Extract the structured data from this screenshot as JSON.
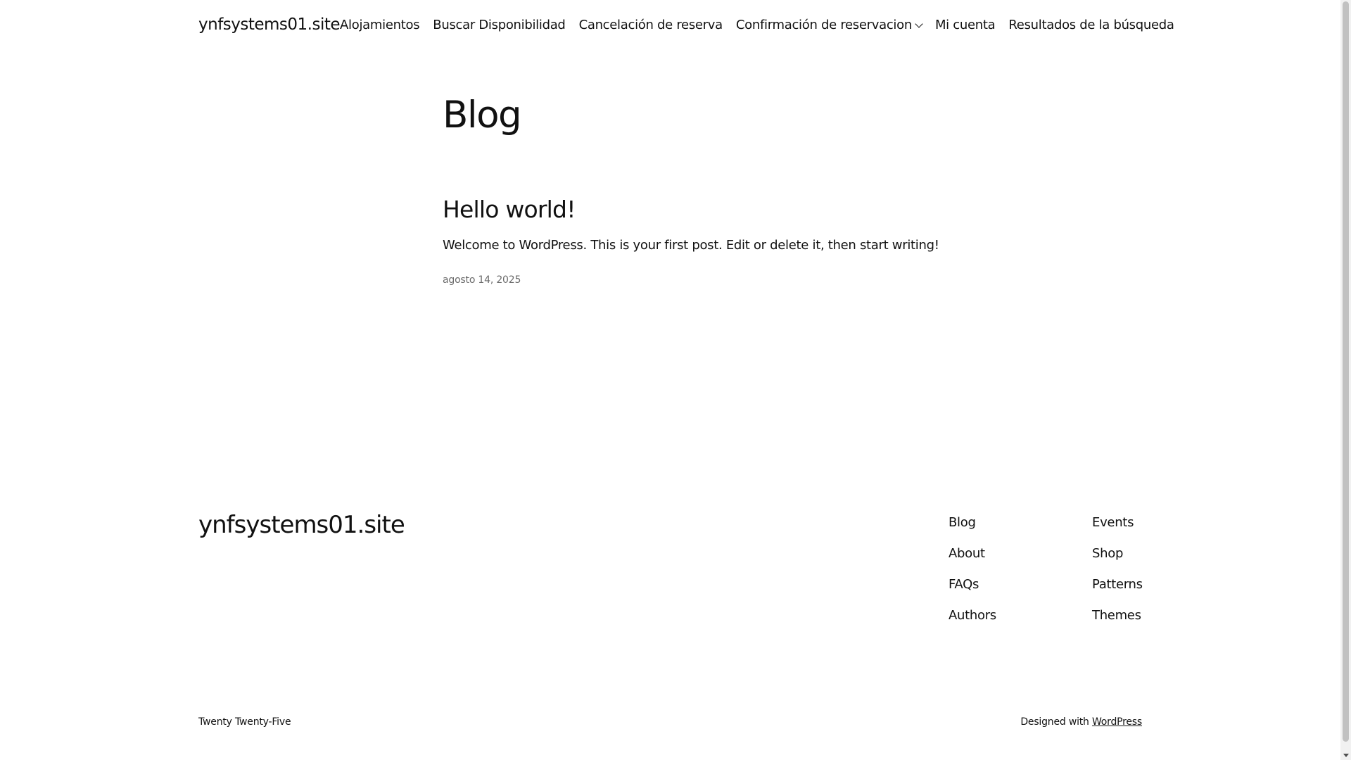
{
  "header": {
    "site_title": "ynfsystems01.site",
    "nav": [
      {
        "label": "Alojamientos"
      },
      {
        "label": "Buscar Disponibilidad"
      },
      {
        "label": "Cancelación de reserva"
      },
      {
        "label": "Confirmación de reservacion",
        "has_submenu": true
      },
      {
        "label": "Mi cuenta"
      },
      {
        "label": "Resultados de la búsqueda"
      }
    ]
  },
  "main": {
    "heading": "Blog",
    "posts": [
      {
        "title": "Hello world!",
        "excerpt": "Welcome to WordPress. This is your first post. Edit or delete it, then start writing!",
        "date": "agosto 14, 2025"
      }
    ]
  },
  "footer": {
    "site_title": "ynfsystems01.site",
    "column_1": [
      "Blog",
      "About",
      "FAQs",
      "Authors"
    ],
    "column_2": [
      "Events",
      "Shop",
      "Patterns",
      "Themes"
    ],
    "theme_name": "Twenty Twenty-Five",
    "credit_prefix": "Designed with ",
    "credit_link": "WordPress"
  },
  "icons": {
    "submenu": "chevron-down-icon"
  },
  "colors": {
    "text": "#111111",
    "muted": "#6b6b6b",
    "background": "#ffffff"
  }
}
